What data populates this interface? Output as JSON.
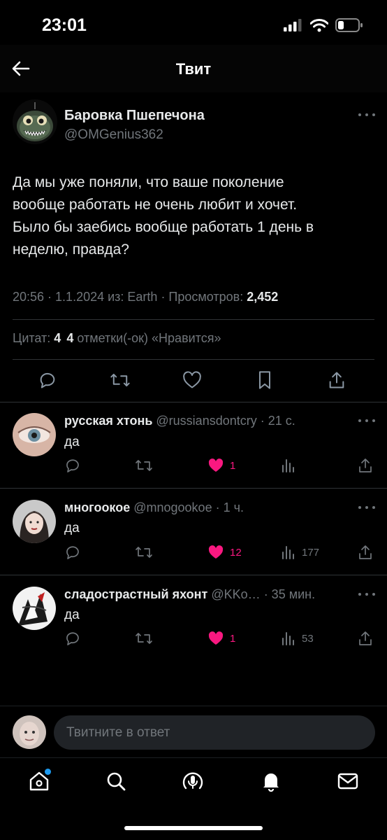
{
  "status_bar": {
    "time": "23:01"
  },
  "header": {
    "title": "Твит"
  },
  "tweet": {
    "author_name": "Баровка Пшепечона",
    "author_handle": "@OMGenius362",
    "text": "Да мы уже поняли, что ваше поколение\nвообще работать не очень любит и хочет.\nБыло бы заебись вообще работать 1 день в\nнеделю, правда?",
    "meta_prefix": "20:56 · 1.1.2024 из: Earth · Просмотров:",
    "views": "2,452",
    "quotes_label": "Цитат:",
    "quotes_count": "4",
    "likes_count": "4",
    "likes_label": "отметки(-ок) «Нравится»"
  },
  "replies": [
    {
      "name": "русская хтонь",
      "handle": "@russiansdontcry",
      "time": "· 21 с.",
      "text": "да",
      "likes": "1",
      "views": "",
      "avatar": "eye-photo"
    },
    {
      "name": "многоокое",
      "handle": "@mnogookoe",
      "time": "· 1 ч.",
      "text": "да",
      "likes": "12",
      "views": "177",
      "avatar": "portrait-photo"
    },
    {
      "name": "сладострастный яхонт",
      "handle": "@KKo…",
      "time": "· 35 мин.",
      "text": "да",
      "likes": "1",
      "views": "53",
      "avatar": "anime-art"
    }
  ],
  "composer": {
    "placeholder": "Твитните в ответ"
  },
  "colors": {
    "like": "#f91880",
    "accent": "#1d9bf0",
    "muted": "#71767b",
    "divider": "#2f3336"
  },
  "icons": [
    "back-arrow-icon",
    "reply-icon",
    "retweet-icon",
    "heart-icon",
    "bookmark-icon",
    "share-icon",
    "views-icon",
    "more-icon",
    "home-icon",
    "search-icon",
    "spaces-icon",
    "bell-icon",
    "mail-icon"
  ]
}
